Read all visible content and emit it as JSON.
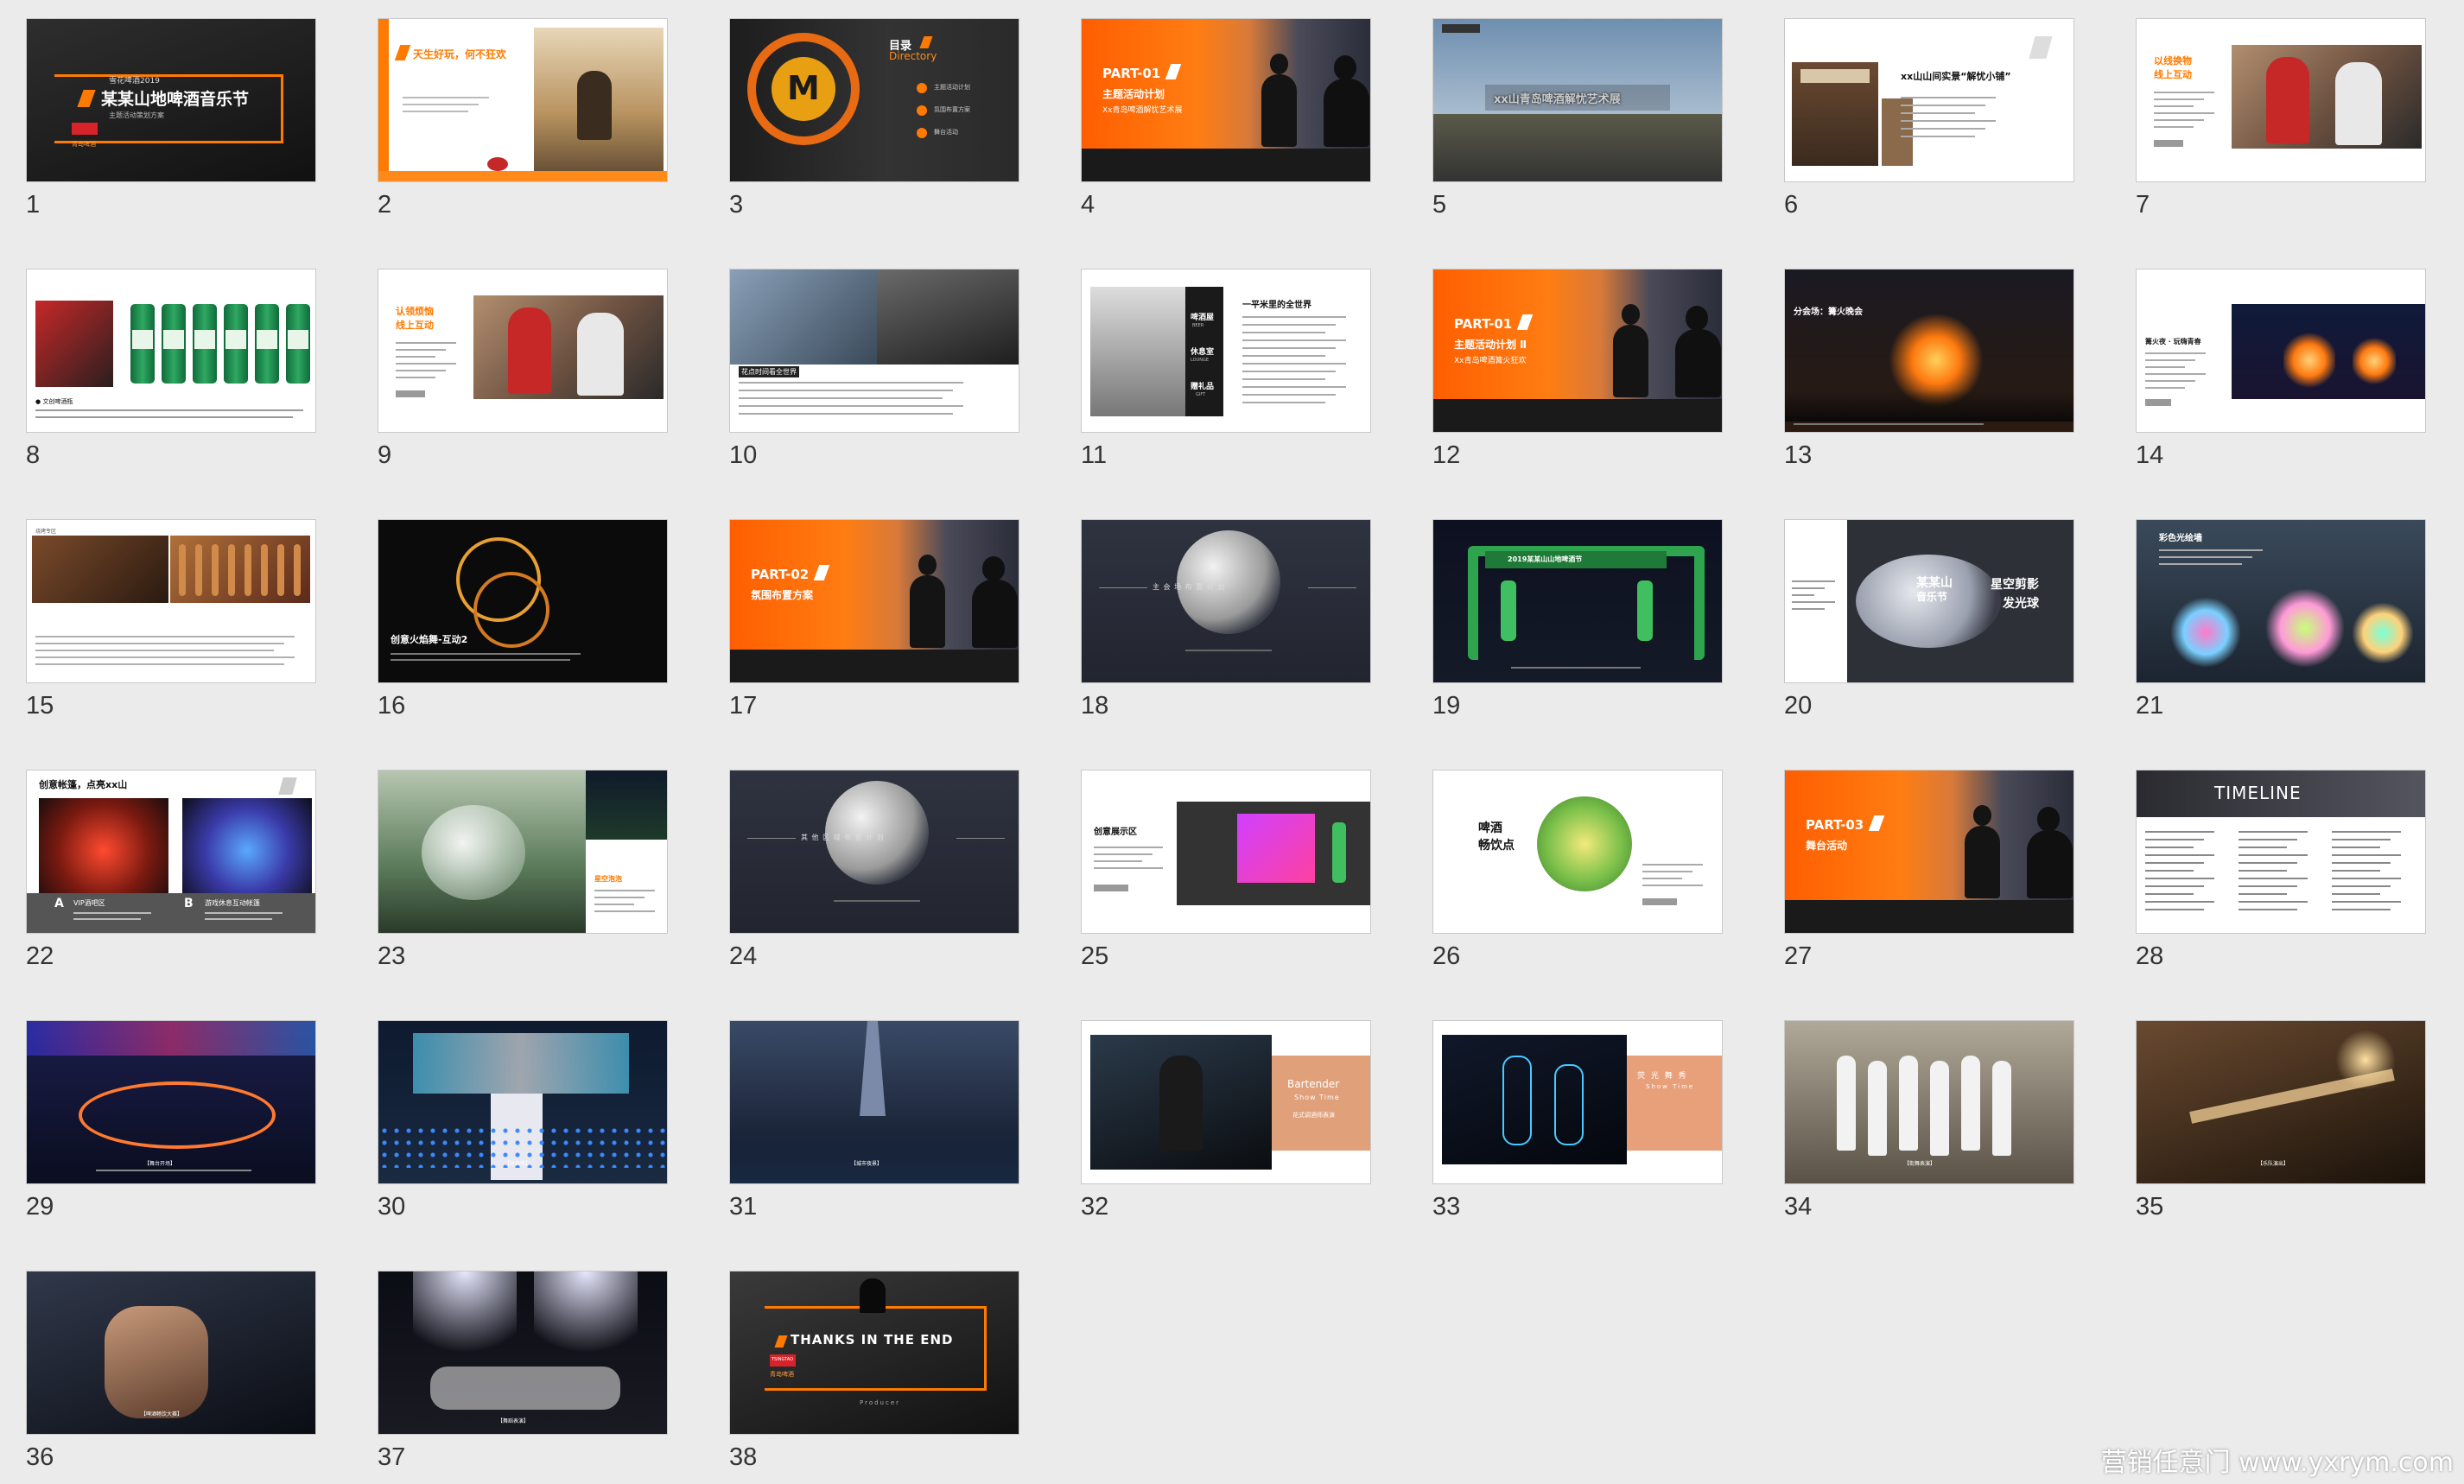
{
  "watermark": "营销任意门 www.yxrym.com",
  "slides": [
    {
      "n": "1",
      "kind": "title",
      "texts": [
        "雪花啤酒2019",
        "某某山地啤酒音乐节",
        "主题活动策划方案",
        "TSINGTAO",
        "青岛啤酒"
      ]
    },
    {
      "n": "2",
      "kind": "intro",
      "texts": [
        "天生好玩，何不狂欢"
      ]
    },
    {
      "n": "3",
      "kind": "directory",
      "texts": [
        "目录",
        "Directory",
        "主题活动计划",
        "氛围布置方案",
        "舞台活动"
      ]
    },
    {
      "n": "4",
      "kind": "part",
      "texts": [
        "PART-01",
        "主题活动计划",
        "Xx青岛啤酒解忧艺术展"
      ]
    },
    {
      "n": "5",
      "kind": "photo-title",
      "texts": [
        "xx山青岛啤酒解忧艺术展"
      ]
    },
    {
      "n": "6",
      "kind": "shop",
      "texts": [
        "xx山山间实景“解忧小铺”"
      ]
    },
    {
      "n": "7",
      "kind": "people",
      "texts": [
        "以线换物",
        "线上互动"
      ]
    },
    {
      "n": "8",
      "kind": "cans",
      "texts": [
        "●  文创啤酒瓶"
      ]
    },
    {
      "n": "9",
      "kind": "people",
      "texts": [
        "认领烦恼",
        "线上互动"
      ]
    },
    {
      "n": "10",
      "kind": "wall",
      "texts": [
        "花点时间看全世界"
      ]
    },
    {
      "n": "11",
      "kind": "lounge",
      "texts": [
        "一平米里的全世界",
        "啤酒屋",
        "BEER",
        "休息室",
        "LOUNGE",
        "赠礼品",
        "GIFT"
      ]
    },
    {
      "n": "12",
      "kind": "part",
      "texts": [
        "PART-01",
        "主题活动计划 Ⅱ",
        "Xx青岛啤酒篝火狂欢"
      ]
    },
    {
      "n": "13",
      "kind": "bonfire",
      "texts": [
        "分会场：篝火晚会"
      ]
    },
    {
      "n": "14",
      "kind": "fire",
      "texts": [
        "篝火夜 · 玩嗨青春"
      ]
    },
    {
      "n": "15",
      "kind": "bbq",
      "texts": [
        "烧烤专区"
      ]
    },
    {
      "n": "16",
      "kind": "fireshow",
      "texts": [
        "创意火焰舞-互动2"
      ]
    },
    {
      "n": "17",
      "kind": "part",
      "texts": [
        "PART-02",
        "氛围布置方案"
      ]
    },
    {
      "n": "18",
      "kind": "moon",
      "texts": [
        "主 会 场 布 置 计 划"
      ]
    },
    {
      "n": "19",
      "kind": "gate",
      "texts": [
        "2019某某山山地啤酒节"
      ]
    },
    {
      "n": "20",
      "kind": "moonshow",
      "texts": [
        "星空剪影",
        "发光球",
        "某某山",
        "音乐节"
      ]
    },
    {
      "n": "21",
      "kind": "lights",
      "texts": [
        "彩色光绘墙"
      ]
    },
    {
      "n": "22",
      "kind": "tents",
      "texts": [
        "创意帐篷，点亮xx山",
        "A",
        "VIP酒吧区",
        "B",
        "游戏休息互动帐篷"
      ]
    },
    {
      "n": "23",
      "kind": "bubble",
      "texts": [
        "星空泡泡"
      ]
    },
    {
      "n": "24",
      "kind": "moon",
      "texts": [
        "其 他 区 域 布 置 计 划"
      ]
    },
    {
      "n": "25",
      "kind": "booth",
      "texts": [
        "创意展示区"
      ]
    },
    {
      "n": "26",
      "kind": "drinks",
      "texts": [
        "啤酒",
        "畅饮点"
      ]
    },
    {
      "n": "27",
      "kind": "part",
      "texts": [
        "PART-03",
        "舞台活动"
      ]
    },
    {
      "n": "28",
      "kind": "timeline",
      "texts": [
        "TIMELINE"
      ]
    },
    {
      "n": "29",
      "kind": "stage",
      "texts": [
        "【舞台开场】"
      ]
    },
    {
      "n": "30",
      "kind": "stage2",
      "texts": [
        "【时装秀】"
      ]
    },
    {
      "n": "31",
      "kind": "suit",
      "texts": [
        "【城市夜景】"
      ]
    },
    {
      "n": "32",
      "kind": "bartender",
      "texts": [
        "Bartender",
        "Show Time",
        "花式调酒师表演"
      ]
    },
    {
      "n": "33",
      "kind": "dance",
      "texts": [
        "荧 光 舞 秀",
        "Show Time"
      ]
    },
    {
      "n": "34",
      "kind": "crew",
      "texts": [
        "【街舞表演】"
      ]
    },
    {
      "n": "35",
      "kind": "guitar",
      "texts": [
        "【乐队演出】"
      ]
    },
    {
      "n": "36",
      "kind": "drink",
      "texts": [
        "【啤酒畅饮大赛】"
      ]
    },
    {
      "n": "37",
      "kind": "dance2",
      "texts": [
        "【舞蹈表演】"
      ]
    },
    {
      "n": "38",
      "kind": "end",
      "texts": [
        "THANKS IN THE END",
        "Producer",
        "TSINGTAO",
        "青岛啤酒"
      ]
    }
  ]
}
